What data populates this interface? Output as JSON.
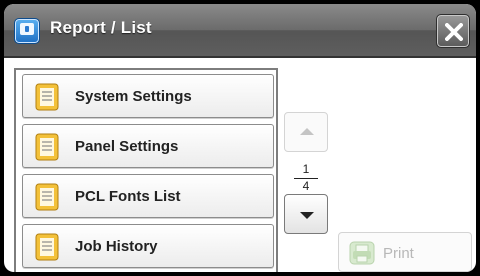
{
  "window": {
    "title": "Report / List"
  },
  "list": {
    "items": [
      {
        "label": "System Settings"
      },
      {
        "label": "Panel Settings"
      },
      {
        "label": "PCL Fonts List"
      },
      {
        "label": "Job History"
      }
    ]
  },
  "pager": {
    "current": "1",
    "total": "4"
  },
  "actions": {
    "print_label": "Print"
  },
  "icons": {
    "app": "report-list-app-icon",
    "close": "close-icon",
    "item": "document-icon",
    "page_up": "chevron-up-icon",
    "page_down": "chevron-down-icon",
    "print": "printer-icon"
  },
  "colors": {
    "titlebar": "#6b6b6b",
    "icon_blue": "#1d6fc4",
    "doc_yellow": "#f3c13a",
    "disabled_text": "#b8b8b8"
  }
}
